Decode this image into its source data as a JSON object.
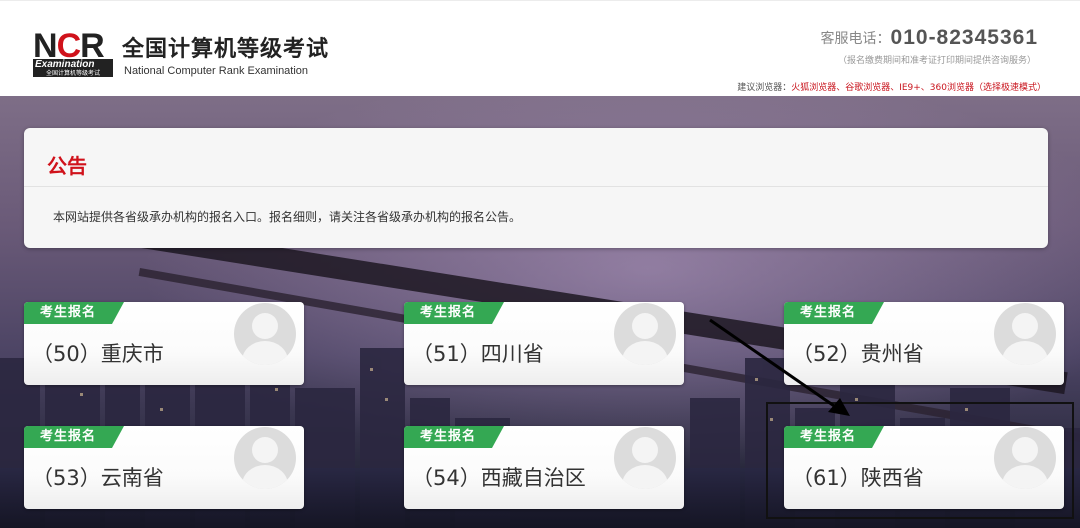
{
  "header": {
    "logo": {
      "mark_prefix": "N",
      "mark_accent": "C",
      "mark_suffix": "R",
      "line1": "Examination",
      "line2": "全国计算机等级考试"
    },
    "title": "全国计算机等级考试",
    "subtitle": "National Computer Rank Examination",
    "hotline_label": "客服电话：",
    "hotline_number": "010-82345361",
    "hotline_note": "（报名缴费期间和准考证打印期间提供咨询服务）",
    "browser_prefix": "建议浏览器：",
    "browser_list": "火狐浏览器、谷歌浏览器、IE9+、360浏览器（选择极速模式）"
  },
  "notice": {
    "title": "公告",
    "text": "本网站提供各省级承办机构的报名入口。报名细则，请关注各省级承办机构的报名公告。"
  },
  "cards": [
    {
      "tag": "考生报名",
      "label": "（50）重庆市"
    },
    {
      "tag": "考生报名",
      "label": "（51）四川省"
    },
    {
      "tag": "考生报名",
      "label": "（52）贵州省"
    },
    {
      "tag": "考生报名",
      "label": "（53）云南省"
    },
    {
      "tag": "考生报名",
      "label": "（54）西藏自治区"
    },
    {
      "tag": "考生报名",
      "label": "（61）陕西省"
    }
  ],
  "colors": {
    "brand_red": "#d0121b",
    "tag_green": "#34a853",
    "notice_bg": "#f6f6f6"
  }
}
